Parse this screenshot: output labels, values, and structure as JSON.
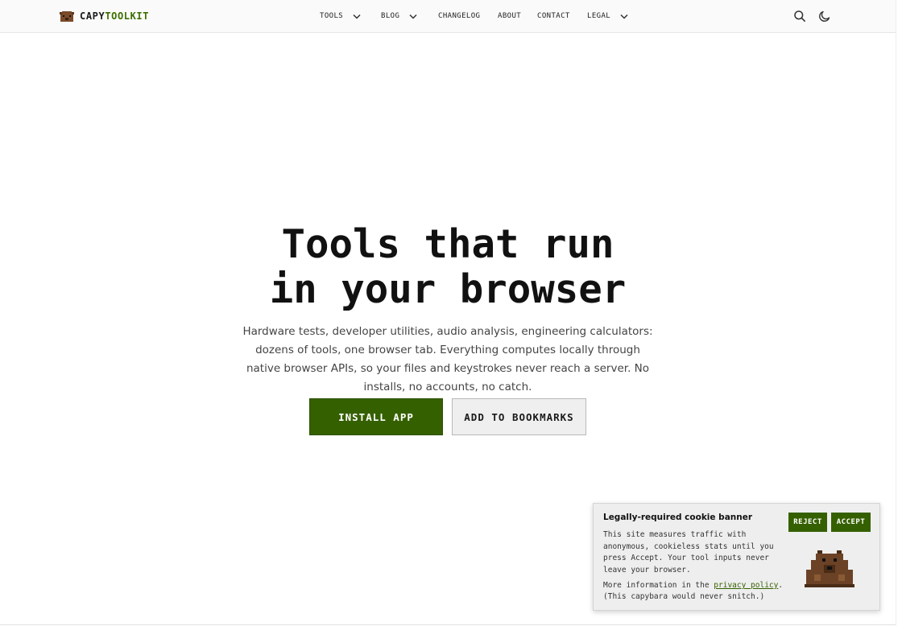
{
  "header": {
    "brand_part1": "CAPY",
    "brand_part2": "TOOLKIT",
    "nav": [
      {
        "label": "TOOLS",
        "has_dropdown": true
      },
      {
        "label": "BLOG",
        "has_dropdown": true
      },
      {
        "label": "CHANGELOG",
        "has_dropdown": false
      },
      {
        "label": "ABOUT",
        "has_dropdown": false
      },
      {
        "label": "CONTACT",
        "has_dropdown": false
      },
      {
        "label": "LEGAL",
        "has_dropdown": true
      }
    ],
    "icons": [
      "search-icon",
      "moon-icon"
    ]
  },
  "hero": {
    "title_line1": "Tools that run",
    "title_line2": "in your browser",
    "description": "Hardware tests, developer utilities, audio analysis, engineering calculators: dozens of tools, one browser tab. Everything computes locally through native browser APIs, so your files and keystrokes never reach a server. No installs, no accounts, no catch.",
    "primary_button": "INSTALL APP",
    "secondary_button": "ADD TO BOOKMARKS"
  },
  "cookie_banner": {
    "title": "Legally-required cookie banner",
    "body": "This site measures traffic with anonymous, cookieless stats until you press Accept. Your tool inputs never leave your browser.",
    "more_prefix": "More information in the ",
    "link_text": "privacy policy",
    "more_suffix": ".",
    "footnote": "(This capybara would never snitch.)",
    "reject_label": "REJECT",
    "accept_label": "ACCEPT"
  },
  "colors": {
    "accent": "#356000",
    "brand_green": "#3c6e00",
    "text": "#1a1a1a",
    "banner_bg": "#eeeeee",
    "capybara": "#6b4226"
  }
}
